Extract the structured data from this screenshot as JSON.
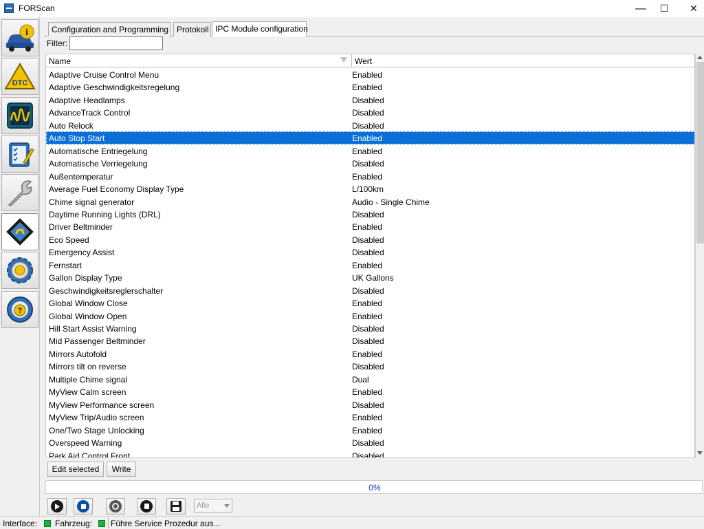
{
  "window": {
    "title": "FORScan",
    "minimize": "—",
    "maximize": "☐",
    "close": "✕"
  },
  "sidebar": {
    "items": [
      {
        "name": "vehicle-info",
        "label": "i"
      },
      {
        "name": "dtc",
        "label": "DTC"
      },
      {
        "name": "oscilloscope",
        "label": ""
      },
      {
        "name": "tests",
        "label": ""
      },
      {
        "name": "service",
        "label": ""
      },
      {
        "name": "configuration",
        "label": ""
      },
      {
        "name": "settings",
        "label": ""
      },
      {
        "name": "help",
        "label": "?"
      }
    ]
  },
  "tabs": [
    {
      "label": "Configuration and Programming"
    },
    {
      "label": "Protokoll"
    },
    {
      "label": "IPC Module configuration"
    }
  ],
  "filter": {
    "label": "Filter:",
    "value": ""
  },
  "table": {
    "columns": [
      "Name",
      "Wert"
    ],
    "rows": [
      {
        "name": "Adaptive Cruise Control Menu",
        "value": "Enabled"
      },
      {
        "name": "Adaptive Geschwindigkeitsregelung",
        "value": "Enabled"
      },
      {
        "name": "Adaptive Headlamps",
        "value": "Disabled"
      },
      {
        "name": "AdvanceTrack Control",
        "value": "Disabled"
      },
      {
        "name": "Auto Relock",
        "value": "Disabled"
      },
      {
        "name": "Auto Stop Start",
        "value": "Enabled"
      },
      {
        "name": "Automatische Entriegelung",
        "value": "Enabled"
      },
      {
        "name": "Automatische Verriegelung",
        "value": "Disabled"
      },
      {
        "name": "Außentemperatur",
        "value": "Enabled"
      },
      {
        "name": "Average Fuel Economy Display Type",
        "value": "L/100km"
      },
      {
        "name": "Chime signal generator",
        "value": "Audio - Single Chime"
      },
      {
        "name": "Daytime Running Lights (DRL)",
        "value": "Disabled"
      },
      {
        "name": "Driver Beltminder",
        "value": "Enabled"
      },
      {
        "name": "Eco Speed",
        "value": "Disabled"
      },
      {
        "name": "Emergency Assist",
        "value": "Disabled"
      },
      {
        "name": "Fernstart",
        "value": "Enabled"
      },
      {
        "name": "Gallon Display Type",
        "value": "UK Gallons"
      },
      {
        "name": "Geschwindigkeitsreglerschalter",
        "value": "Disabled"
      },
      {
        "name": "Global Window Close",
        "value": "Enabled"
      },
      {
        "name": "Global Window Open",
        "value": "Enabled"
      },
      {
        "name": "Hill Start Assist Warning",
        "value": "Disabled"
      },
      {
        "name": "Mid Passenger Beltminder",
        "value": "Disabled"
      },
      {
        "name": "Mirrors Autofold",
        "value": "Enabled"
      },
      {
        "name": "Mirrors tilt on reverse",
        "value": "Disabled"
      },
      {
        "name": "Multiple Chime signal",
        "value": "Dual"
      },
      {
        "name": "MyView Calm screen",
        "value": "Enabled"
      },
      {
        "name": "MyView Performance screen",
        "value": "Disabled"
      },
      {
        "name": "MyView Trip/Audio screen",
        "value": "Enabled"
      },
      {
        "name": "One/Two Stage Unlocking",
        "value": "Enabled"
      },
      {
        "name": "Overspeed Warning",
        "value": "Disabled"
      },
      {
        "name": "Park Aid Control Front",
        "value": "Disabled"
      }
    ],
    "selected_index": 5
  },
  "buttons": {
    "edit_selected": "Edit selected",
    "write": "Write"
  },
  "progress": {
    "text": "0%",
    "value": 0
  },
  "toolbar": {
    "combo_value": "Alle"
  },
  "status": {
    "interface": "Interface:",
    "vehicle": "Fahrzeug:",
    "message": "Führe Service Prozedur aus..."
  },
  "colors": {
    "selection": "#0a6fd6",
    "status_ok": "#1db23c",
    "progress_text": "#1f3fcc"
  }
}
